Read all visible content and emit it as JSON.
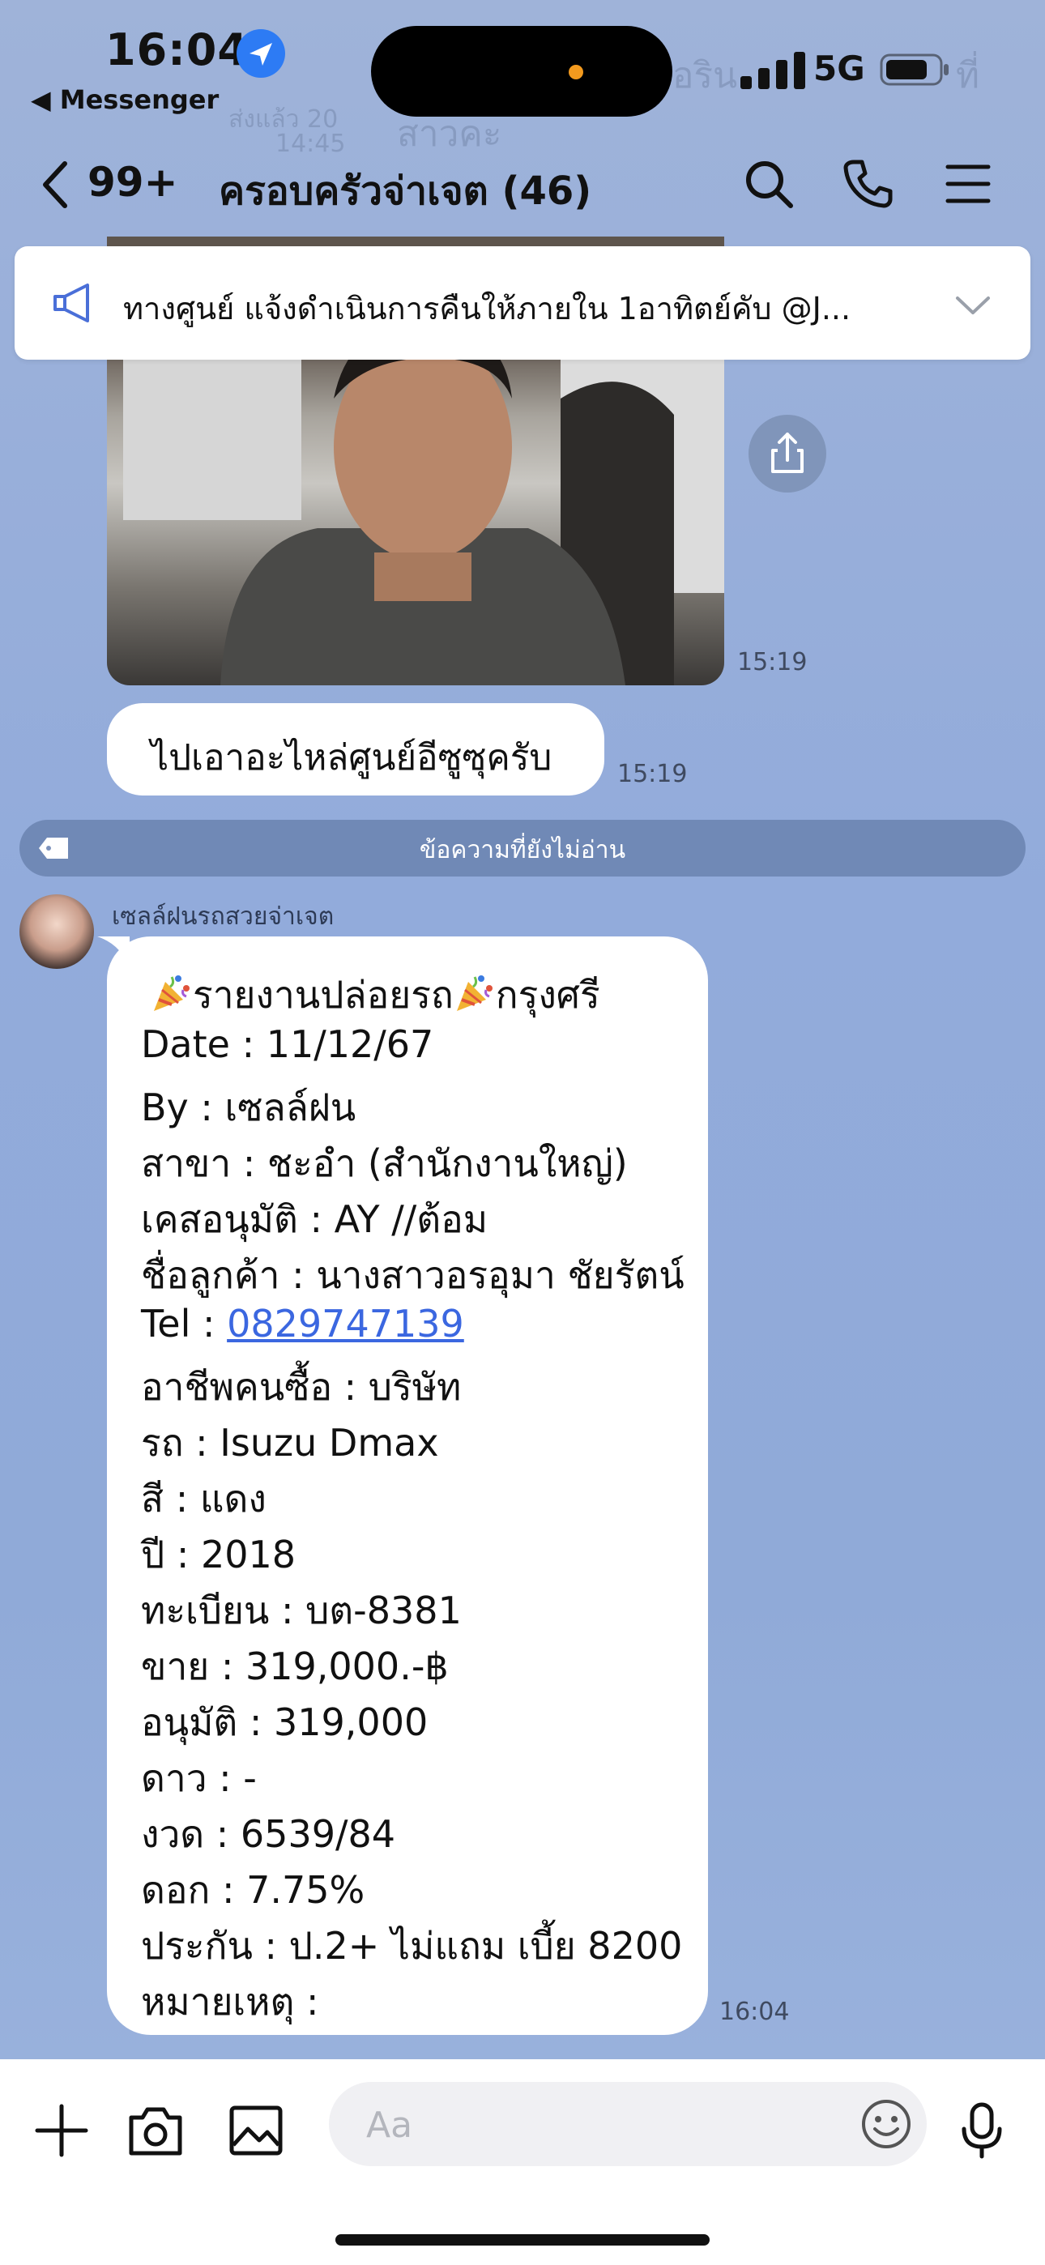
{
  "status_bar": {
    "time": "16:04",
    "back_app": "◀ Messenger",
    "network": "5G",
    "accent": "#2d7bf4"
  },
  "background_ghost": {
    "line1": "ส่งแล้ว 20",
    "line2": "14:45",
    "line3": "สาวคะ",
    "line4": "อริน",
    "line5": "ที่"
  },
  "header": {
    "back_icon": "chevron-left-icon",
    "unread_count": "99+",
    "title": "ครอบครัวจ่าเจต (46)",
    "icons": [
      "search-icon",
      "phone-icon",
      "menu-icon"
    ]
  },
  "announcement": {
    "icon": "megaphone-icon",
    "text": "ทางศูนย์ แจ้งดำเนินการคืนให้ภายใน 1อาทิตย์คับ @J..."
  },
  "messages": {
    "photo_time": "15:19",
    "text1": "ไปเอาอะไหล่ศูนย์อีซูซุครับ",
    "text1_time": "15:19",
    "unread_divider": "ข้อความที่ยังไม่อ่าน",
    "sender": "เซลล์ฝนรถสวยจ่าเจต",
    "report": {
      "title": "รายงานปล่อยรถ",
      "title_suffix": "กรุงศรี",
      "date": "Date : 11/12/67",
      "by": "By : เซลล์ฝน",
      "branch": "สาขา : ชะอำ (สำนักงานใหญ่)",
      "approved_case": "เคสอนุมัติ : AY //ต้อม",
      "customer": "ชื่อลูกค้า : นางสาวอรอุมา ชัยรัตน์",
      "tel_label": "Tel : ",
      "tel": "0829747139",
      "occupation": "อาชีพคนซื้อ : บริษัท",
      "car": "รถ : Isuzu Dmax",
      "color": "สี : แดง",
      "year": "ปี : 2018",
      "plate": "ทะเบียน : บต-8381",
      "price": "ขาย : 319,000.-฿",
      "approved": "อนุมัติ : 319,000",
      "down": "ดาว : -",
      "installment": "งวด : 6539/84",
      "interest": "ดอก : 7.75%",
      "insurance": "ประกัน : ป.2+ ไม่แถม เบี้ย 8200",
      "note": "หมายเหตุ :"
    },
    "report_time": "16:04"
  },
  "composer": {
    "placeholder": "Aa",
    "icons": [
      "plus-icon",
      "camera-icon",
      "image-icon",
      "emoji-icon",
      "microphone-icon"
    ]
  }
}
